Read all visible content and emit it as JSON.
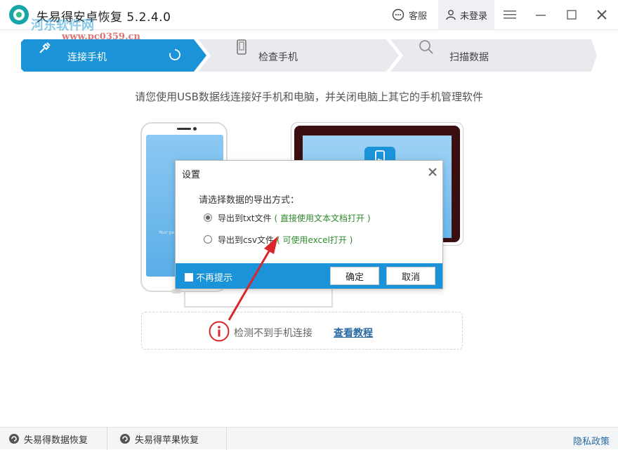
{
  "window": {
    "title": "失易得安卓恢复 5.2.4.0",
    "service_label": "客服",
    "login_label": "未登录"
  },
  "watermark": {
    "text": "河东软件网",
    "url": "www.pc0359.cn"
  },
  "steps": [
    {
      "label": "连接手机",
      "active": true
    },
    {
      "label": "检查手机",
      "active": false
    },
    {
      "label": "扫描数据",
      "active": false
    }
  ],
  "instruction": "请您使用USB数据线连接好手机和电脑，并关闭电脑上其它的手机管理软件",
  "phone_screen_text": "Your pe",
  "dialog": {
    "title": "设置",
    "question": "请选择数据的导出方式：",
    "options": [
      {
        "label": "导出到txt文件",
        "note": "( 直接使用文本文档打开 )",
        "checked": true
      },
      {
        "label": "导出到csv文件",
        "note": "( 可使用excel打开 )",
        "checked": false
      }
    ],
    "checkbox_label": "不再提示",
    "confirm_label": "确定",
    "cancel_label": "取消"
  },
  "hint": {
    "text": "检测不到手机连接",
    "link": "查看教程"
  },
  "bottom": {
    "item1": "失易得数据恢复",
    "item2": "失易得苹果恢复",
    "privacy": "隐私政策"
  },
  "colors": {
    "accent": "#1a93d9",
    "step_inactive": "#e8eaed",
    "arrow_red": "#d8262c"
  }
}
